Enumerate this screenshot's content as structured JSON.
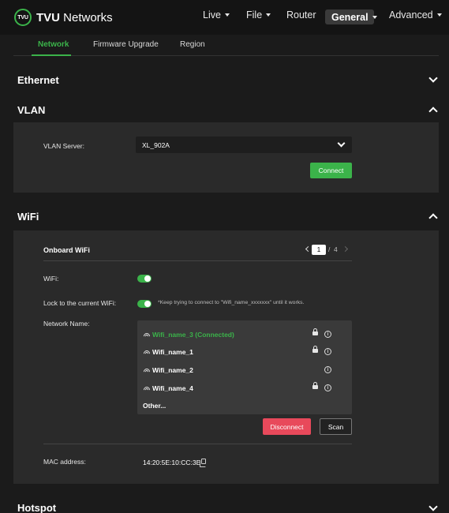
{
  "header": {
    "logo_mark": "TVU",
    "logo_bold": "TVU",
    "logo_rest": " Networks",
    "nav": {
      "live": "Live",
      "file": "File",
      "router": "Router",
      "general": "General",
      "advanced": "Advanced"
    }
  },
  "subtabs": {
    "network": "Network",
    "firmware": "Firmware Upgrade",
    "region": "Region"
  },
  "sections": {
    "ethernet": "Ethernet",
    "vlan": "VLAN",
    "wifi": "WiFi",
    "hotspot": "Hotspot"
  },
  "vlan": {
    "server_label": "VLAN Server:",
    "server_value": "XL_902A",
    "connect_label": "Connect"
  },
  "wifi": {
    "panel_title": "Onboard WiFi",
    "pager": {
      "current": "1",
      "separator": "/",
      "total": "4"
    },
    "wifi_label": "WiFi:",
    "lock_label": "Lock to the current WiFi:",
    "lock_note": "*Keep trying to connect to \"Wifi_name_xxxxxxx\" until it works.",
    "network_label": "Network Name:",
    "networks": [
      {
        "name": "Wifi_name_3 (Connected)",
        "locked": true
      },
      {
        "name": "Wifi_name_1",
        "locked": true
      },
      {
        "name": "Wifi_name_2",
        "locked": false
      },
      {
        "name": "Wifi_name_4",
        "locked": true
      }
    ],
    "other_label": "Other...",
    "disconnect_label": "Disconnect",
    "scan_label": "Scan",
    "mac_label": "MAC address:",
    "mac_value": "14:20:5E:10:CC:3E"
  },
  "colors": {
    "accent": "#3bb34a",
    "danger": "#e8495b",
    "background": "#1b1b1b",
    "panel": "#2a2a2a"
  }
}
